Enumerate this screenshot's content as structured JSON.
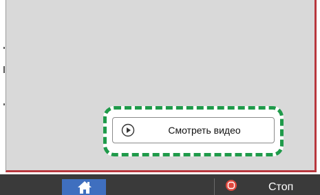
{
  "video": {
    "label": "Смотреть видео",
    "icon": "play-circle-icon"
  },
  "bottom_bar": {
    "home_icon": "home-icon",
    "stop_label": "Стоп",
    "stop_icon": "stop-icon"
  },
  "colors": {
    "panel_bg": "#d9d9d9",
    "panel_border": "#b8383e",
    "highlight": "#1f9a4a",
    "home_button": "#3f6fbf",
    "stop_icon": "#e0483d",
    "bottom_bar": "#3a3a3a"
  }
}
